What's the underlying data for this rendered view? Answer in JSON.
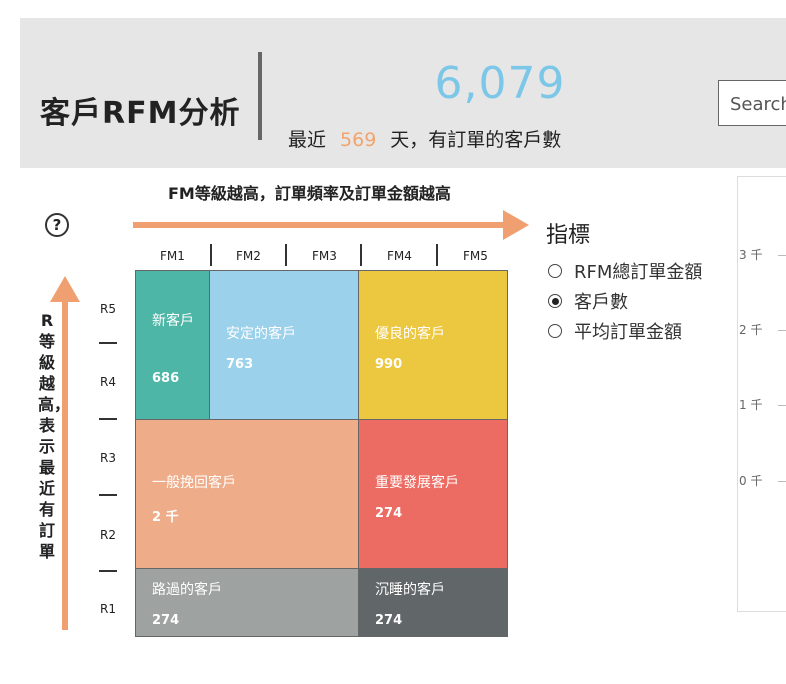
{
  "header": {
    "title": "客戶RFM分析",
    "kpi_value": "6,079",
    "kpi_caption_prefix": "最近",
    "kpi_days": "569",
    "kpi_caption_suffix": "天，有訂單的客戶數",
    "search_text": "Search"
  },
  "help_icon_glyph": "?",
  "fm_axis": {
    "caption": "FM等級越高，訂單頻率及訂單金額越高",
    "labels": [
      "FM1",
      "FM2",
      "FM3",
      "FM4",
      "FM5"
    ]
  },
  "r_axis": {
    "caption": "R等級越高，表示最近有訂單",
    "labels": [
      "R5",
      "R4",
      "R3",
      "R2",
      "R1"
    ]
  },
  "segments": [
    {
      "name": "新客戶",
      "count": "686",
      "color": "#4db6a6"
    },
    {
      "name": "安定的客戶",
      "count": "763",
      "color": "#9bd1ea"
    },
    {
      "name": "優良的客戶",
      "count": "990",
      "color": "#ecc740"
    },
    {
      "name": "一般挽回客戶",
      "count": "2 千",
      "color": "#efac88"
    },
    {
      "name": "重要發展客戶",
      "count": "274",
      "color": "#ec6b62"
    },
    {
      "name": "路過的客戶",
      "count": "274",
      "color": "#9ea2a1"
    },
    {
      "name": "沉睡的客戶",
      "count": "274",
      "color": "#616668"
    }
  ],
  "metric": {
    "title": "指標",
    "options": [
      {
        "label": "RFM總訂單金額",
        "selected": false
      },
      {
        "label": "客戶數",
        "selected": true
      },
      {
        "label": "平均訂單金額",
        "selected": false
      }
    ]
  },
  "chart": {
    "y_ticks": [
      "3 千",
      "2 千",
      "1 千",
      "0 千"
    ]
  },
  "colors": {
    "header_bg": "#e6e6e6",
    "kpi_value": "#7cc7e8",
    "kpi_days": "#f3a36b",
    "arrow": "#f0a070"
  }
}
